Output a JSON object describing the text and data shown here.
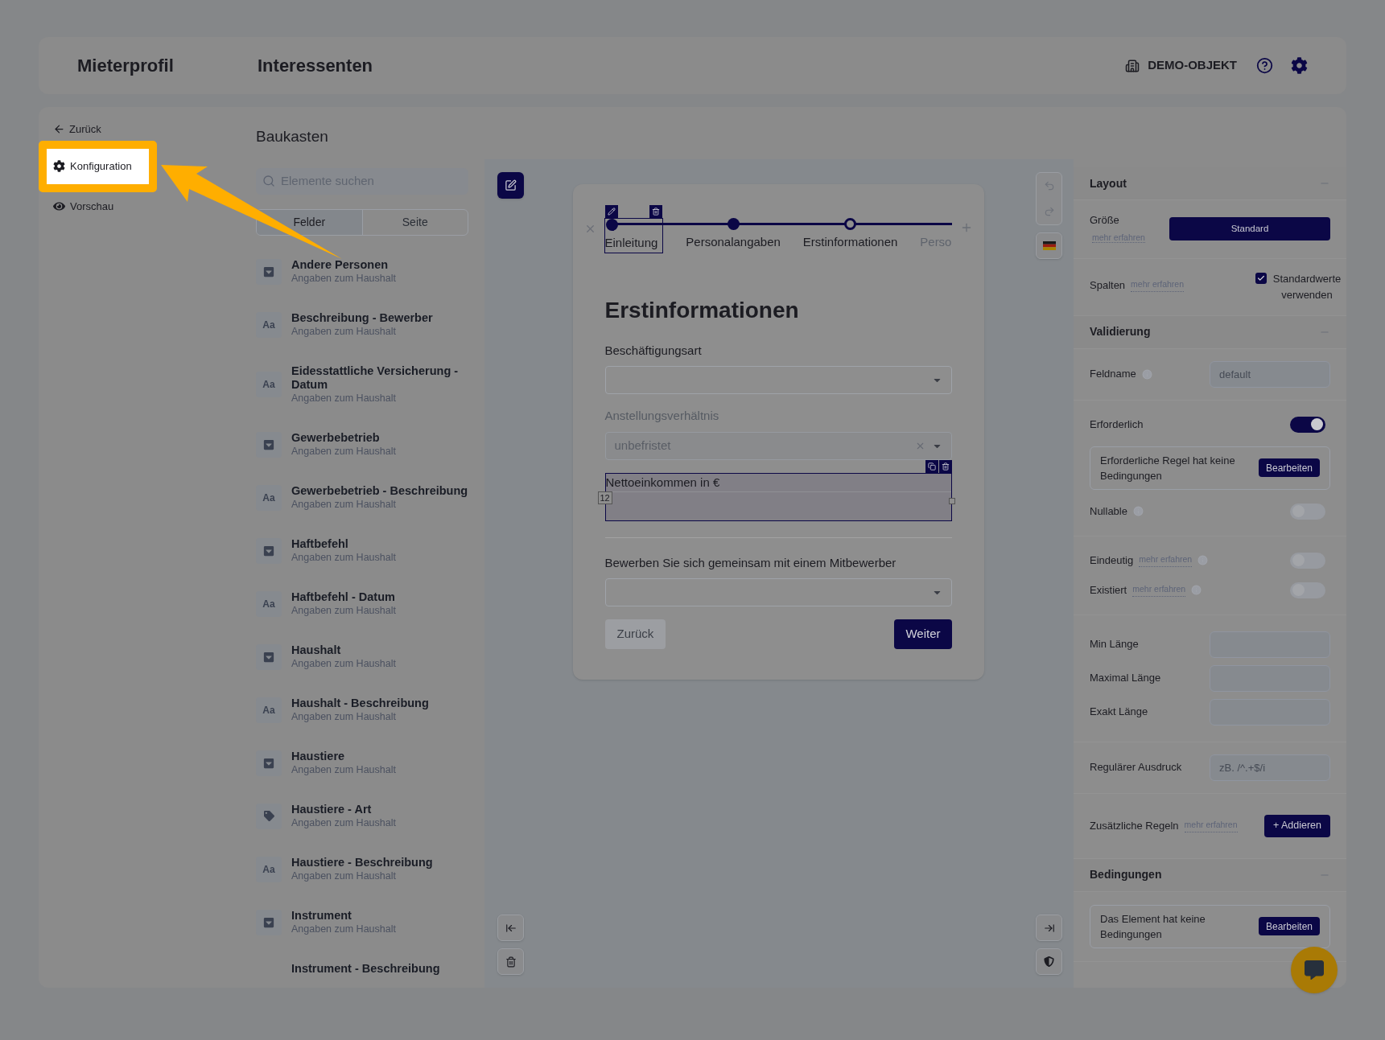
{
  "header": {
    "title": "Mieterprofil",
    "section": "Interessenten",
    "object": "DEMO-OBJEKT"
  },
  "nav": {
    "back": "Zurück",
    "items": [
      {
        "label": "Konfiguration",
        "kind": "config",
        "selected": true
      },
      {
        "label": "Vorschau",
        "kind": "preview",
        "selected": false
      }
    ]
  },
  "builder": {
    "title": "Baukasten",
    "search_placeholder": "Elemente suchen",
    "tabs": [
      {
        "label": "Felder",
        "selected": true
      },
      {
        "label": "Seite",
        "selected": false
      }
    ],
    "elements": [
      {
        "name": "Andere Personen",
        "group": "Angaben zum Haushalt",
        "kind": "select"
      },
      {
        "name": "Beschreibung - Bewerber",
        "group": "Angaben zum Haushalt",
        "kind": "text",
        "glyph": "Aa"
      },
      {
        "name": "Eidesstattliche Versicherung - Datum",
        "group": "Angaben zum Haushalt",
        "kind": "text",
        "glyph": "Aa"
      },
      {
        "name": "Gewerbebetrieb",
        "group": "Angaben zum Haushalt",
        "kind": "select"
      },
      {
        "name": "Gewerbebetrieb - Beschreibung",
        "group": "Angaben zum Haushalt",
        "kind": "text",
        "glyph": "Aa"
      },
      {
        "name": "Haftbefehl",
        "group": "Angaben zum Haushalt",
        "kind": "select"
      },
      {
        "name": "Haftbefehl - Datum",
        "group": "Angaben zum Haushalt",
        "kind": "text",
        "glyph": "Aa"
      },
      {
        "name": "Haushalt",
        "group": "Angaben zum Haushalt",
        "kind": "select"
      },
      {
        "name": "Haushalt - Beschreibung",
        "group": "Angaben zum Haushalt",
        "kind": "text",
        "glyph": "Aa"
      },
      {
        "name": "Haustiere",
        "group": "Angaben zum Haushalt",
        "kind": "select"
      },
      {
        "name": "Haustiere - Art",
        "group": "Angaben zum Haushalt",
        "kind": "tag"
      },
      {
        "name": "Haustiere - Beschreibung",
        "group": "Angaben zum Haushalt",
        "kind": "text",
        "glyph": "Aa"
      },
      {
        "name": "Instrument",
        "group": "Angaben zum Haushalt",
        "kind": "select"
      },
      {
        "name": "Instrument - Beschreibung",
        "kind": "text"
      }
    ]
  },
  "form": {
    "steps": [
      {
        "label": "Einleitung",
        "kind": "done",
        "selected": true
      },
      {
        "label": "Personalangaben",
        "kind": "done",
        "selected": false
      },
      {
        "label": "Erstinformationen",
        "kind": "current",
        "selected": false
      },
      {
        "label": "Perso",
        "kind": "upcoming",
        "selected": false
      }
    ],
    "heading": "Erstinformationen",
    "fields": [
      {
        "kind": "select",
        "label": "Beschäftigungsart",
        "disabled": false,
        "selected": false
      },
      {
        "kind": "select",
        "label": "Anstellungsverhältnis",
        "value": "unbefristet",
        "disabled": true,
        "selected": false
      },
      {
        "kind": "textarea",
        "label": "Nettoeinkommen in €",
        "badge": "12",
        "disabled": false,
        "selected": true
      },
      {
        "kind": "divider",
        "selected": false
      },
      {
        "kind": "select",
        "label": "Bewerben Sie sich gemeinsam mit einem Mitbewerber",
        "disabled": false,
        "selected": false
      }
    ],
    "back": "Zurück",
    "next": "Weiter"
  },
  "settings": {
    "sections": [
      {
        "title": "Layout",
        "expanded": true,
        "groups": [
          [
            {
              "kind": "choice",
              "label": "Größe",
              "link": "mehr erfahren",
              "value": "Standard"
            }
          ],
          [
            {
              "kind": "checkbox",
              "label": "Spalten",
              "link": "mehr erfahren",
              "option": "Standardwerte verwenden",
              "checked": true
            }
          ]
        ]
      },
      {
        "title": "Validierung",
        "expanded": true,
        "groups": [
          [
            {
              "kind": "input",
              "label": "Feldname",
              "info": true,
              "placeholder": "default"
            }
          ],
          [
            {
              "kind": "toggle",
              "label": "Erforderlich",
              "on": true
            },
            {
              "kind": "rule",
              "text": "Erforderliche Regel hat keine Bedingungen",
              "action": "Bearbeiten"
            },
            {
              "kind": "toggle",
              "label": "Nullable",
              "info": true,
              "on": false
            }
          ],
          [
            {
              "kind": "toggle",
              "label": "Eindeutig",
              "link": "mehr erfahren",
              "info": true,
              "on": false
            },
            {
              "kind": "toggle",
              "label": "Existiert",
              "link": "mehr erfahren",
              "info": true,
              "on": false
            }
          ],
          [
            {
              "kind": "input",
              "label": "Min Länge"
            },
            {
              "kind": "input",
              "label": "Maximal Länge"
            },
            {
              "kind": "input",
              "label": "Exakt Länge"
            }
          ],
          [
            {
              "kind": "input",
              "label": "Regulärer Ausdruck",
              "placeholder": "zB. /^.+$/i"
            }
          ],
          [
            {
              "kind": "action",
              "label": "Zusätzliche Regeln",
              "link": "mehr erfahren",
              "action": "+ Addieren"
            }
          ]
        ]
      },
      {
        "title": "Bedingungen",
        "expanded": true,
        "groups": [
          [
            {
              "kind": "rule",
              "text": "Das Element hat keine Bedingungen",
              "action": "Bearbeiten"
            }
          ]
        ]
      }
    ]
  }
}
